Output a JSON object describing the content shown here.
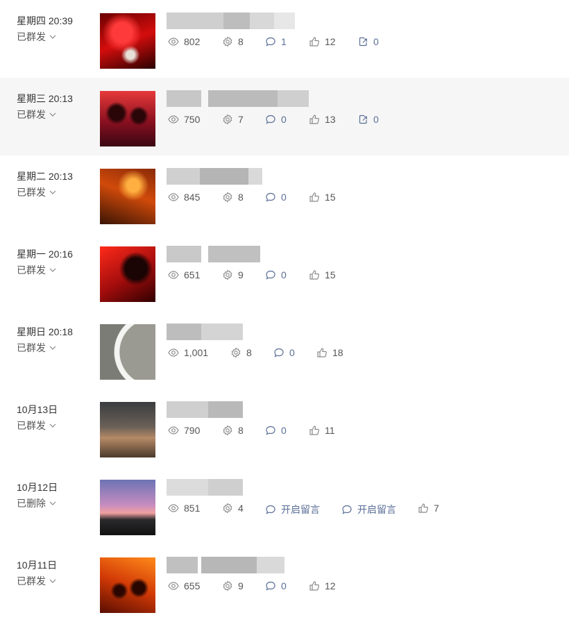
{
  "rows": [
    {
      "date": "星期四 20:39",
      "status": "已群发",
      "stats": [
        {
          "icon": "eye-icon",
          "value": "802"
        },
        {
          "icon": "gear-icon",
          "value": "8"
        },
        {
          "icon": "comment-icon",
          "value": "1"
        },
        {
          "icon": "thumb-up-icon",
          "value": "12"
        },
        {
          "icon": "share-icon",
          "value": "0"
        }
      ]
    },
    {
      "date": "星期三 20:13",
      "status": "已群发",
      "stats": [
        {
          "icon": "eye-icon",
          "value": "750"
        },
        {
          "icon": "gear-icon",
          "value": "7"
        },
        {
          "icon": "comment-icon",
          "value": "0"
        },
        {
          "icon": "thumb-up-icon",
          "value": "13"
        },
        {
          "icon": "share-icon",
          "value": "0"
        }
      ]
    },
    {
      "date": "星期二 20:13",
      "status": "已群发",
      "stats": [
        {
          "icon": "eye-icon",
          "value": "845"
        },
        {
          "icon": "gear-icon",
          "value": "8"
        },
        {
          "icon": "comment-icon",
          "value": "0"
        },
        {
          "icon": "thumb-up-icon",
          "value": "15"
        }
      ]
    },
    {
      "date": "星期一 20:16",
      "status": "已群发",
      "stats": [
        {
          "icon": "eye-icon",
          "value": "651"
        },
        {
          "icon": "gear-icon",
          "value": "9"
        },
        {
          "icon": "comment-icon",
          "value": "0"
        },
        {
          "icon": "thumb-up-icon",
          "value": "15"
        }
      ]
    },
    {
      "date": "星期日 20:18",
      "status": "已群发",
      "stats": [
        {
          "icon": "eye-icon",
          "value": "1,001"
        },
        {
          "icon": "gear-icon",
          "value": "8"
        },
        {
          "icon": "comment-icon",
          "value": "0"
        },
        {
          "icon": "thumb-up-icon",
          "value": "18"
        }
      ]
    },
    {
      "date": "10月13日",
      "status": "已群发",
      "stats": [
        {
          "icon": "eye-icon",
          "value": "790"
        },
        {
          "icon": "gear-icon",
          "value": "8"
        },
        {
          "icon": "comment-icon",
          "value": "0"
        },
        {
          "icon": "thumb-up-icon",
          "value": "11"
        }
      ]
    },
    {
      "date": "10月12日",
      "status": "已删除",
      "stats": [
        {
          "icon": "eye-icon",
          "value": "851"
        },
        {
          "icon": "gear-icon",
          "value": "4"
        },
        {
          "icon": "comment-icon",
          "value": "开启留言"
        },
        {
          "icon": "comment-icon",
          "value": "开启留言"
        },
        {
          "icon": "thumb-up-icon",
          "value": "7"
        }
      ]
    },
    {
      "date": "10月11日",
      "status": "已群发",
      "stats": [
        {
          "icon": "eye-icon",
          "value": "655"
        },
        {
          "icon": "gear-icon",
          "value": "9"
        },
        {
          "icon": "comment-icon",
          "value": "0"
        },
        {
          "icon": "thumb-up-icon",
          "value": "12"
        }
      ]
    }
  ]
}
